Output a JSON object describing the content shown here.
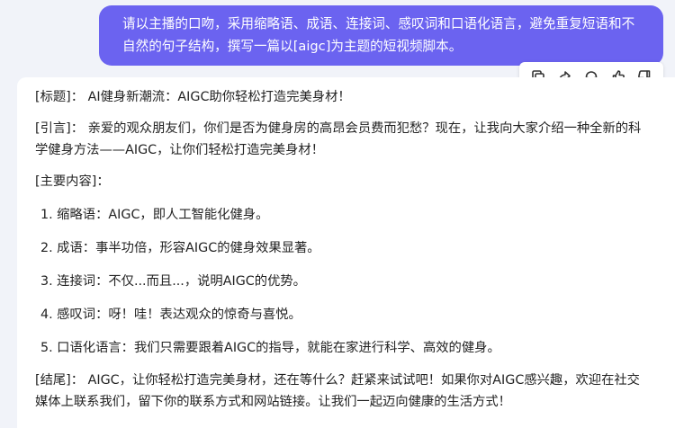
{
  "user_message": {
    "line1": "请以主播的口吻，采用缩略语、成语、连接词、感叹词和口语化语言，避免重复短语和不",
    "line2": "自然的句子结构，撰写一篇以[aigc]为主题的短视频脚本。"
  },
  "actions": [
    {
      "icon": "copy-icon"
    },
    {
      "icon": "share-icon"
    },
    {
      "icon": "headphones-icon"
    },
    {
      "icon": "thumbs-up-icon"
    },
    {
      "icon": "thumbs-down-icon"
    }
  ],
  "answer": {
    "title": "[标题]：  AI健身新潮流：AIGC助你轻松打造完美身材！",
    "intro_line1": "[引言]：  亲爱的观众朋友们，你们是否为健身房的高昂会员费而犯愁？现在，让我向大家介绍一种全新的科",
    "intro_line2": "学健身方法——AIGC，让你们轻松打造完美身材！",
    "main_heading": "[主要内容]：",
    "points": [
      "1. 缩略语：AIGC，即人工智能化健身。",
      "2. 成语：事半功倍，形容AIGC的健身效果显著。",
      "3. 连接词：不仅...而且...，说明AIGC的优势。",
      "4. 感叹词：呀！哇！表达观众的惊奇与喜悦。",
      "5. 口语化语言：我们只需要跟着AIGC的指导，就能在家进行科学、高效的健身。"
    ],
    "ending_line1": "[结尾]：  AIGC，让你轻松打造完美身材，还在等什么？赶紧来试试吧！如果你对AIGC感兴趣，欢迎在社交",
    "ending_line2": "媒体上联系我们，留下你的联系方式和网站链接。让我们一起迈向健康的生活方式！"
  }
}
